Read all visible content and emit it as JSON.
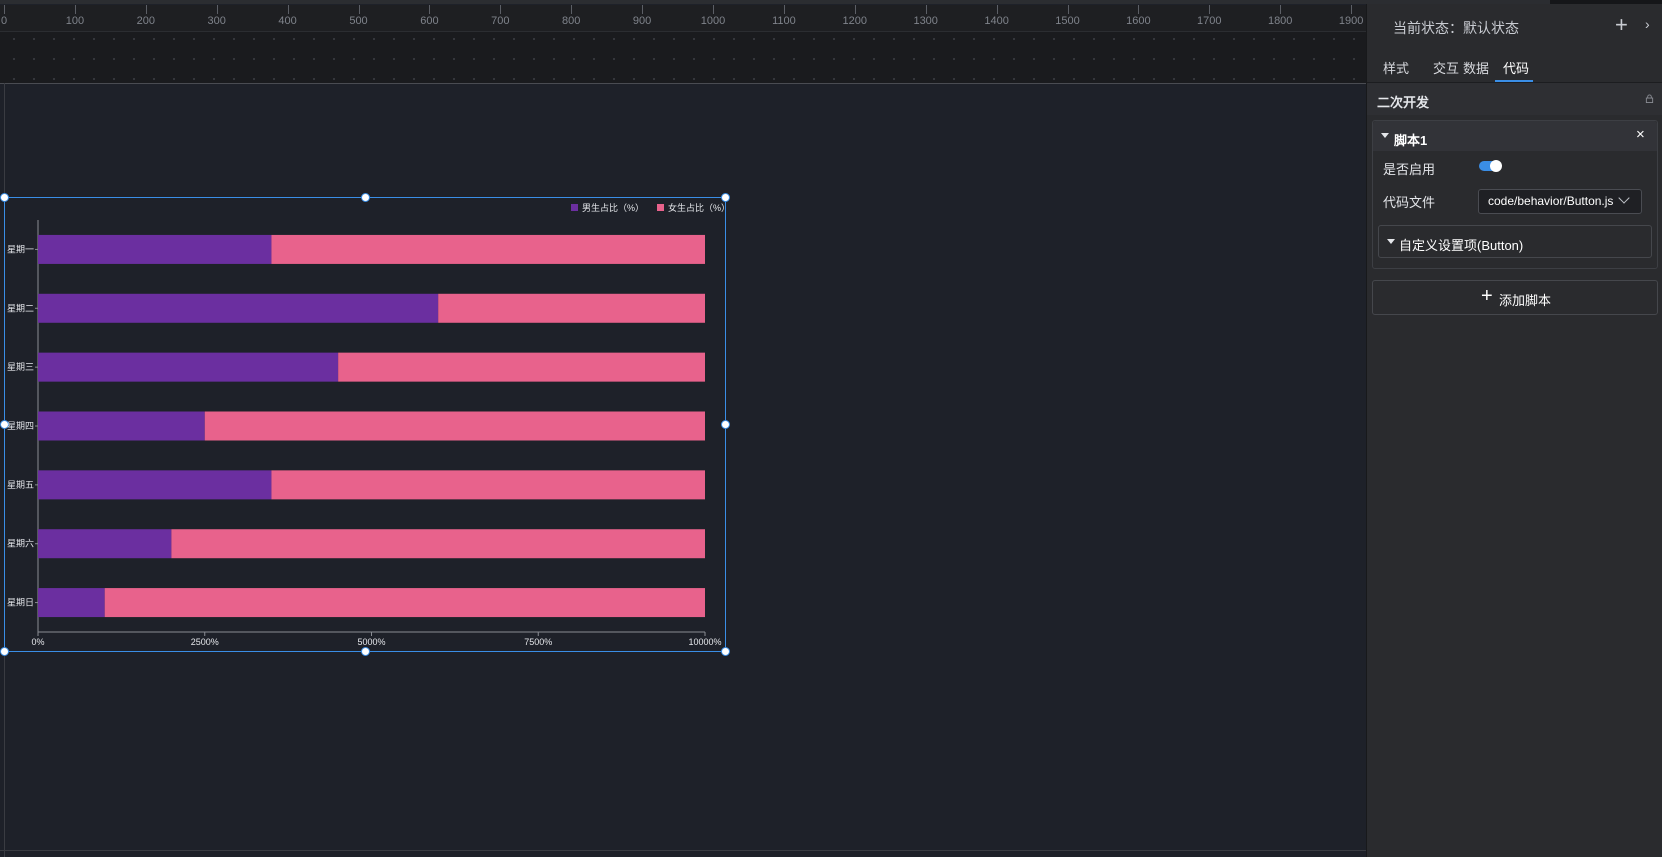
{
  "ruler": {
    "ticks": [
      "0",
      "100",
      "200",
      "300",
      "400",
      "500",
      "600",
      "700",
      "800",
      "900",
      "1000",
      "1100",
      "1200",
      "1300",
      "1400",
      "1500",
      "1600",
      "1700",
      "1800",
      "1900"
    ]
  },
  "chart_data": {
    "type": "bar",
    "orientation": "horizontal",
    "stacked": true,
    "categories": [
      "星期一",
      "星期二",
      "星期三",
      "星期四",
      "星期五",
      "星期六",
      "星期日"
    ],
    "series": [
      {
        "name": "男生占比（%）",
        "color": "#6b2fa0",
        "values": [
          35,
          60,
          45,
          25,
          35,
          20,
          10
        ]
      },
      {
        "name": "女生占比（%）",
        "color": "#e8628c",
        "values": [
          65,
          40,
          55,
          75,
          65,
          80,
          90
        ]
      }
    ],
    "xticks": [
      "0%",
      "2500%",
      "5000%",
      "7500%",
      "10000%"
    ],
    "xlim": [
      0,
      100
    ],
    "legend": "top-right",
    "grid": false
  },
  "panel": {
    "state_label": "当前状态：默认状态",
    "add_state_icon": "+",
    "collapse_icon": "›",
    "tabs": [
      "样式",
      "交互",
      "数据",
      "代码"
    ],
    "active_tab": "代码",
    "section_title": "二次开发",
    "script": {
      "title": "脚本1",
      "close_icon": "×",
      "enabled_label": "是否启用",
      "enabled": true,
      "file_label": "代码文件",
      "file_value": "code/behavior/Button.js",
      "custom_title": "自定义设置项(Button)"
    },
    "add_script_icon": "+",
    "add_script_label": "添加脚本"
  },
  "colors": {
    "accent": "#3a8ee6",
    "male": "#6b2fa0",
    "female": "#e8628c"
  }
}
